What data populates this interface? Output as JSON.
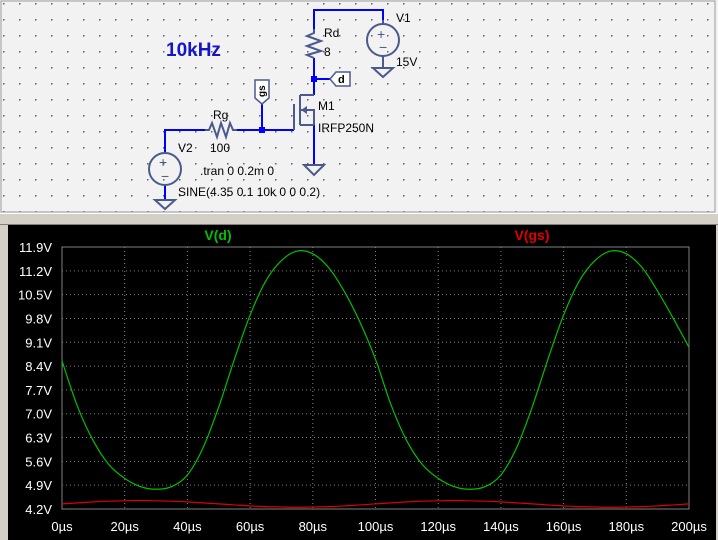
{
  "schematic": {
    "annotation": "10kHz",
    "components": {
      "rd": {
        "name": "Rd",
        "value": "8"
      },
      "rg": {
        "name": "Rg",
        "value": "100"
      },
      "v1": {
        "name": "V1",
        "value": "15V"
      },
      "v2": {
        "name": "V2"
      },
      "m1": {
        "name": "M1",
        "value": "IRFP250N"
      }
    },
    "net_labels": {
      "drain": "d",
      "gate": "gs"
    },
    "directives": {
      "tran": ".tran 0 0.2m 0",
      "source": "SINE(4.35 0.1 10k 0 0 0 2)"
    }
  },
  "colors": {
    "schematic_bg": "#f2f2f2",
    "wire": "#0000ff",
    "component": "#4a5a8a",
    "annotation": "#1414c8",
    "plot_bg": "#000000",
    "grid": "#808080",
    "trace_vd": "#00c000",
    "trace_vgs": "#e00000",
    "axis_text": "#ffffff"
  },
  "chart_data": {
    "type": "line",
    "x_unit": "µs",
    "x_ticks": [
      "0µs",
      "20µs",
      "40µs",
      "60µs",
      "80µs",
      "100µs",
      "120µs",
      "140µs",
      "160µs",
      "180µs",
      "200µs"
    ],
    "y_ticks": [
      "4.2V",
      "4.9V",
      "5.6V",
      "6.3V",
      "7.0V",
      "7.7V",
      "8.4V",
      "9.1V",
      "9.8V",
      "10.5V",
      "11.2V",
      "11.9V"
    ],
    "xlim": [
      0,
      200
    ],
    "ylim": [
      4.2,
      11.9
    ],
    "grid": true,
    "series": [
      {
        "name": "V(d)",
        "color": "#00c000",
        "x": [
          0,
          5,
          10,
          15,
          20,
          25,
          30,
          35,
          40,
          45,
          50,
          55,
          60,
          65,
          70,
          75,
          80,
          85,
          90,
          95,
          100,
          105,
          110,
          115,
          120,
          125,
          130,
          135,
          140,
          145,
          150,
          155,
          160,
          165,
          170,
          175,
          180,
          185,
          190,
          195,
          200
        ],
        "y": [
          8.55,
          7.2,
          6.2,
          5.5,
          5.1,
          4.86,
          4.78,
          4.86,
          5.2,
          6.0,
          7.2,
          8.6,
          9.9,
          10.9,
          11.5,
          11.78,
          11.7,
          11.3,
          10.6,
          9.7,
          8.6,
          7.25,
          6.2,
          5.5,
          5.1,
          4.86,
          4.78,
          4.86,
          5.2,
          6.0,
          7.2,
          8.6,
          9.9,
          10.9,
          11.5,
          11.78,
          11.7,
          11.3,
          10.6,
          9.8,
          8.95
        ]
      },
      {
        "name": "V(gs)",
        "color": "#e00000",
        "x": [
          0,
          5,
          10,
          15,
          20,
          25,
          30,
          35,
          40,
          45,
          50,
          55,
          60,
          65,
          70,
          75,
          80,
          85,
          90,
          95,
          100,
          105,
          110,
          115,
          120,
          125,
          130,
          135,
          140,
          145,
          150,
          155,
          160,
          165,
          170,
          175,
          180,
          185,
          190,
          195,
          200
        ],
        "y": [
          4.35,
          4.38,
          4.41,
          4.43,
          4.44,
          4.45,
          4.44,
          4.43,
          4.41,
          4.38,
          4.35,
          4.32,
          4.29,
          4.27,
          4.26,
          4.25,
          4.26,
          4.27,
          4.29,
          4.32,
          4.35,
          4.38,
          4.41,
          4.43,
          4.44,
          4.45,
          4.44,
          4.43,
          4.41,
          4.38,
          4.35,
          4.32,
          4.29,
          4.27,
          4.26,
          4.25,
          4.26,
          4.27,
          4.29,
          4.32,
          4.35
        ]
      }
    ]
  }
}
